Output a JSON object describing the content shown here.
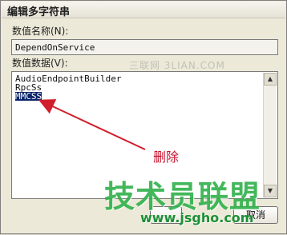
{
  "dialog": {
    "title": "编辑多字符串",
    "value_name_label": "数值名称(N):",
    "value_name": "DependOnService",
    "value_data_label": "数值数据(V):",
    "value_data_lines": [
      "AudioEndpointBuilder",
      "RpcSs",
      "MMCSS"
    ],
    "selected_line": "MMCSS",
    "buttons": {
      "cancel_label": "取消"
    }
  },
  "annotation": {
    "text": "删除",
    "color": "#c8102e"
  },
  "watermarks": {
    "top": "三联网 3LIAN.COM",
    "logo": "技术员联盟",
    "url": "www.jsgho.com"
  }
}
